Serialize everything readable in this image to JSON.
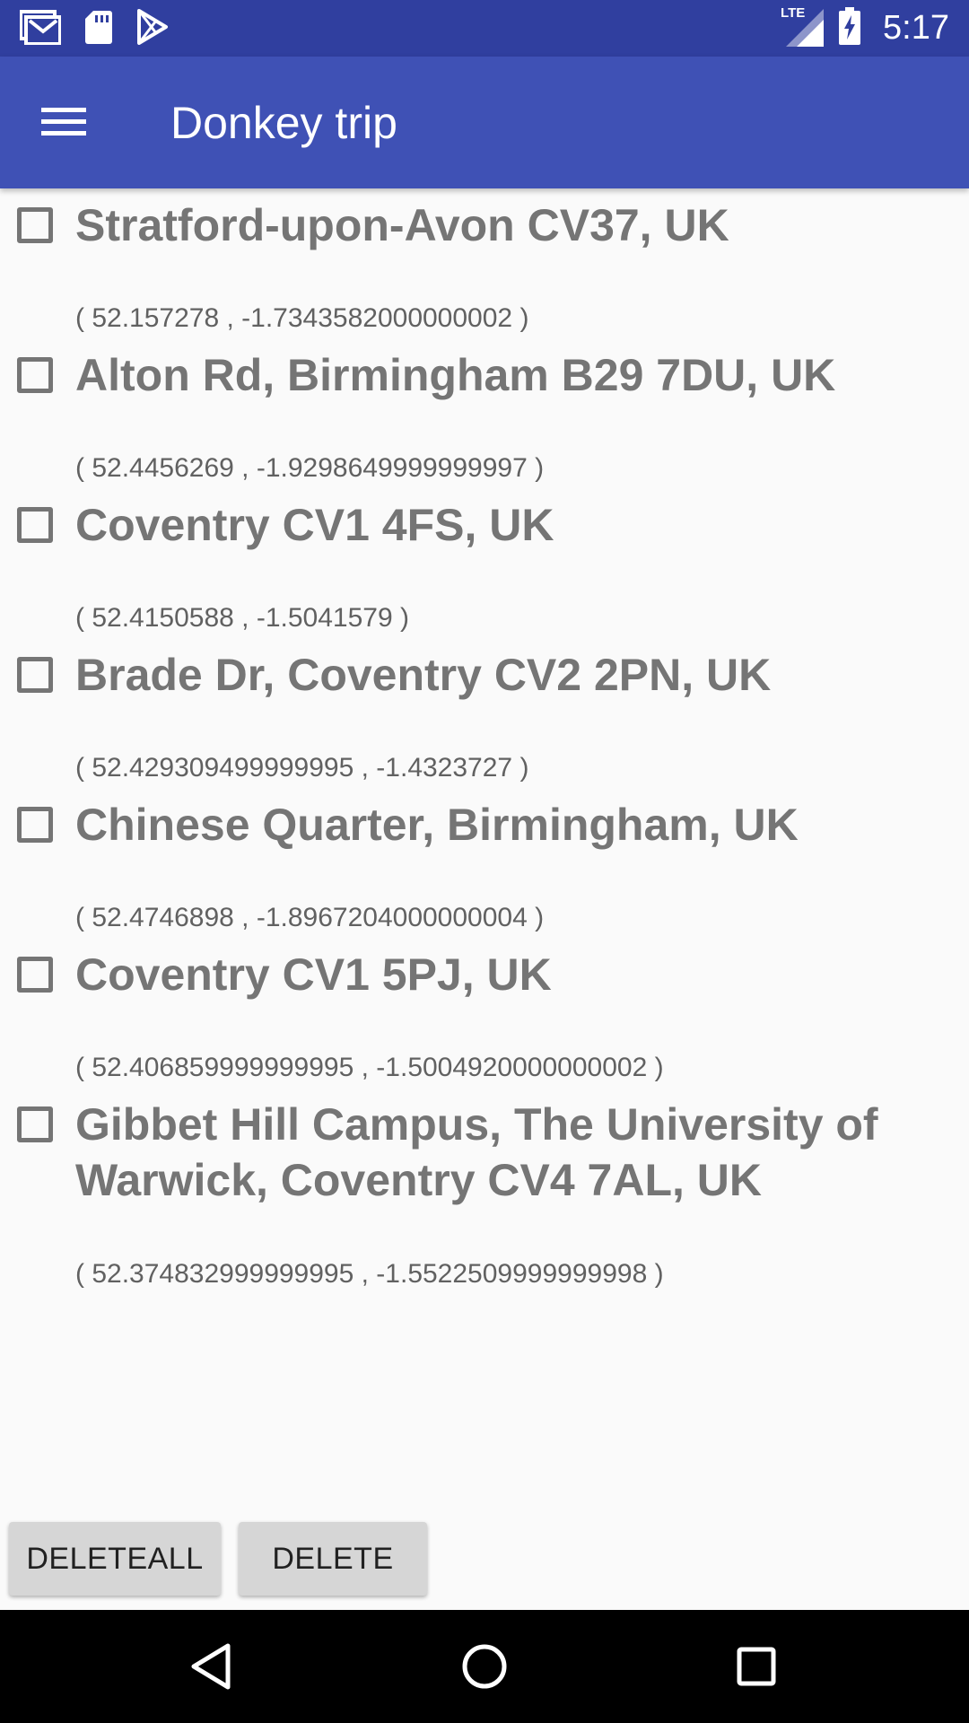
{
  "status_bar": {
    "icons_left": [
      "gmail-icon",
      "sd-card-icon",
      "play-store-icon"
    ],
    "network": "LTE",
    "time": "5:17"
  },
  "app_bar": {
    "menu_icon": "hamburger-menu-icon",
    "title": "Donkey trip"
  },
  "locations": [
    {
      "name": "Stratford-upon-Avon CV37, UK",
      "coords": "( 52.157278 , -1.7343582000000002 )",
      "checked": false
    },
    {
      "name": "Alton Rd, Birmingham B29 7DU, UK",
      "coords": "( 52.4456269 , -1.9298649999999997 )",
      "checked": false
    },
    {
      "name": "Coventry CV1 4FS, UK",
      "coords": "( 52.4150588 , -1.5041579 )",
      "checked": false
    },
    {
      "name": "Brade Dr, Coventry CV2 2PN, UK",
      "coords": "( 52.429309499999995 , -1.4323727 )",
      "checked": false
    },
    {
      "name": "Chinese Quarter, Birmingham, UK",
      "coords": "( 52.4746898 , -1.8967204000000004 )",
      "checked": false
    },
    {
      "name": "Coventry CV1 5PJ, UK",
      "coords": "( 52.406859999999995 , -1.5004920000000002 )",
      "checked": false
    },
    {
      "name": "Gibbet Hill Campus, The University of Warwick, Coventry CV4 7AL, UK",
      "coords": "( 52.374832999999995 , -1.5522509999999998 )",
      "checked": false
    }
  ],
  "buttons": {
    "delete_all": "DELETEALL",
    "delete": "DELETE"
  },
  "nav_bar": {
    "back": "back-icon",
    "home": "home-icon",
    "recents": "recents-icon"
  },
  "colors": {
    "status_bar": "#303f9f",
    "app_bar": "#3f51b5",
    "text_gray": "#757575"
  }
}
